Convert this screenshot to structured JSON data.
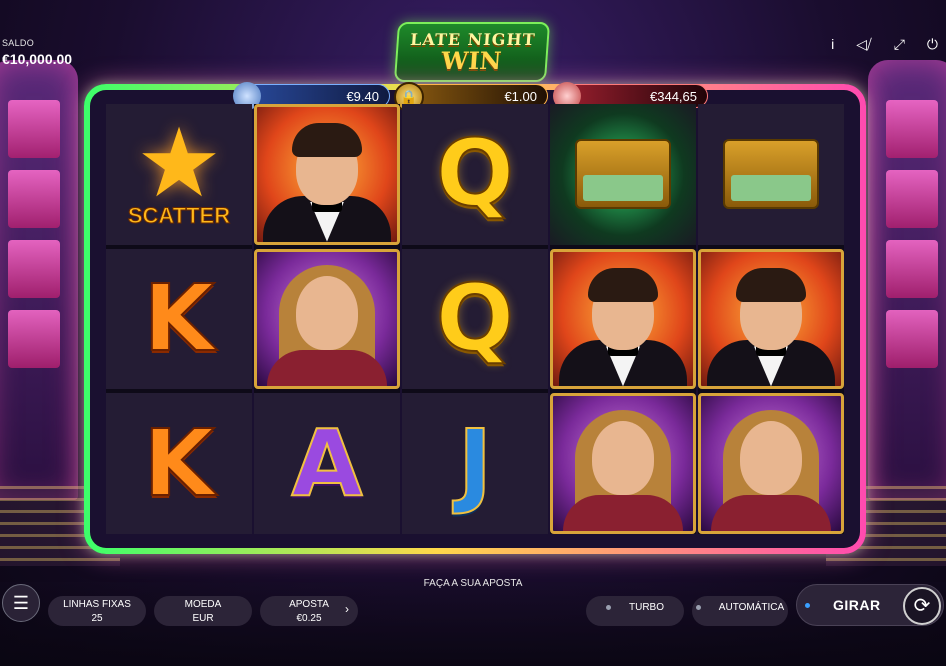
{
  "balance": {
    "label": "SALDO",
    "value": "€10,000.00"
  },
  "top_icons": {
    "info": "i",
    "sound": "◁⧸",
    "fullscreen": "⤢",
    "power": "⏻"
  },
  "logo": {
    "line1": "LATE NIGHT",
    "line2": "WIN"
  },
  "jackpots": {
    "left": "€9.40",
    "middle": "€1.00",
    "right": "€344,65"
  },
  "reels": [
    [
      {
        "type": "scatter",
        "label": "SCATTER"
      },
      {
        "type": "letter",
        "value": "K"
      },
      {
        "type": "letter",
        "value": "K"
      }
    ],
    [
      {
        "type": "man"
      },
      {
        "type": "woman"
      },
      {
        "type": "letter",
        "value": "A"
      }
    ],
    [
      {
        "type": "letter",
        "value": "Q"
      },
      {
        "type": "letter",
        "value": "Q"
      },
      {
        "type": "letter",
        "value": "J"
      }
    ],
    [
      {
        "type": "cash-case"
      },
      {
        "type": "man"
      },
      {
        "type": "woman"
      }
    ],
    [
      {
        "type": "cash-case"
      },
      {
        "type": "man"
      },
      {
        "type": "woman"
      }
    ]
  ],
  "bottom": {
    "prompt": "FAÇA A SUA APOSTA",
    "lines_label": "LINHAS FIXAS",
    "lines_value": "25",
    "coin_label": "MOEDA",
    "coin_value": "EUR",
    "bet_label": "APOSTA",
    "bet_value": "€0.25",
    "turbo_label": "TURBO",
    "auto_label": "AUTOMÁTICA",
    "spin_label": "GIRAR"
  }
}
